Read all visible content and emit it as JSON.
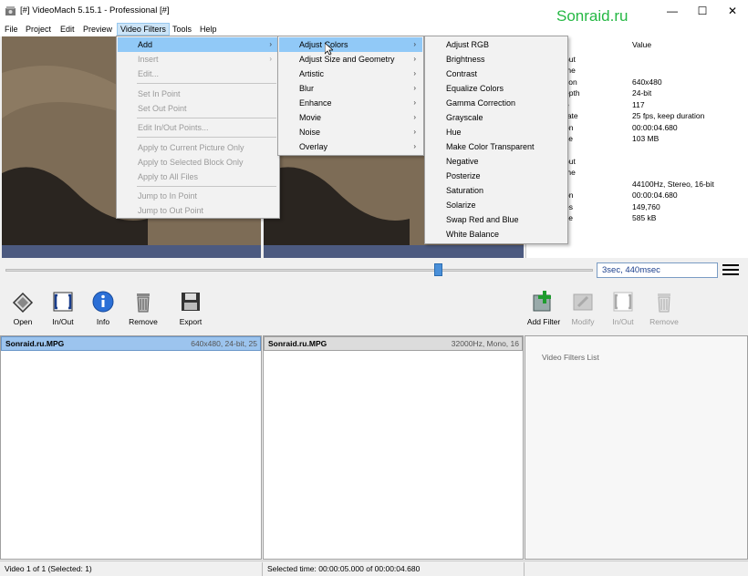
{
  "window": {
    "title": "[#] VideoMach 5.15.1 - Professional [#]",
    "watermark": "Sonraid.ru",
    "minimize": "—",
    "maximize": "☐",
    "close": "✕"
  },
  "menubar": [
    "File",
    "Project",
    "Edit",
    "Preview",
    "Video Filters",
    "Tools",
    "Help"
  ],
  "menus": {
    "video_filters": {
      "items": [
        {
          "label": "Add",
          "enabled": true,
          "submenu": true,
          "highlighted": true
        },
        {
          "label": "Insert",
          "enabled": false,
          "submenu": true
        },
        {
          "label": "Edit...",
          "enabled": false
        },
        {
          "label": "Set In Point",
          "enabled": false
        },
        {
          "label": "Set Out Point",
          "enabled": false
        },
        {
          "label": "Edit In/Out Points...",
          "enabled": false
        },
        {
          "label": "Apply to Current Picture Only",
          "enabled": false
        },
        {
          "label": "Apply to Selected Block Only",
          "enabled": false
        },
        {
          "label": "Apply to All Files",
          "enabled": false
        },
        {
          "label": "Jump to In Point",
          "enabled": false
        },
        {
          "label": "Jump to Out Point",
          "enabled": false
        }
      ]
    },
    "add": {
      "items": [
        "Adjust Colors",
        "Adjust Size and Geometry",
        "Artistic",
        "Blur",
        "Enhance",
        "Movie",
        "Noise",
        "Overlay"
      ],
      "highlighted": "Adjust Colors"
    },
    "adjust_colors": {
      "items": [
        "Adjust RGB",
        "Brightness",
        "Contrast",
        "Equalize Colors",
        "Gamma Correction",
        "Grayscale",
        "Hue",
        "Make Color Transparent",
        "Negative",
        "Posterize",
        "Saturation",
        "Solarize",
        "Swap Red and Blue",
        "White Balance"
      ]
    }
  },
  "properties": {
    "header": "Value",
    "rows": [
      {
        "key": "put",
        "value": ""
      },
      {
        "key": "me",
        "value": ""
      },
      {
        "key": "tion",
        "value": "640x480"
      },
      {
        "key": "epth",
        "value": "24-bit"
      },
      {
        "key": "e",
        "value": "117"
      },
      {
        "key": "rate",
        "value": "25 fps, keep duration"
      },
      {
        "key": "on",
        "value": "00:00:04.680"
      },
      {
        "key": "ze",
        "value": "103 MB"
      },
      {
        "key": "put",
        "value": ""
      },
      {
        "key": "me",
        "value": ""
      },
      {
        "key": "",
        "value": "44100Hz, Stereo, 16-bit"
      },
      {
        "key": "on",
        "value": "00:00:04.680"
      },
      {
        "key": "es",
        "value": "149,760"
      },
      {
        "key": "ze",
        "value": "585 kB"
      }
    ]
  },
  "seek": {
    "time": "3sec, 440msec",
    "position": 0.73
  },
  "toolbar_left": [
    {
      "label": "Open",
      "icon": "open-icon"
    },
    {
      "label": "In/Out",
      "icon": "inout-icon"
    },
    {
      "label": "Info",
      "icon": "info-icon"
    },
    {
      "label": "Remove",
      "icon": "trash-icon"
    },
    {
      "label": "Export",
      "icon": "save-icon"
    }
  ],
  "toolbar_right": [
    {
      "label": "Add Filter",
      "icon": "add-filter-icon",
      "enabled": true
    },
    {
      "label": "Modify",
      "icon": "modify-icon",
      "enabled": false
    },
    {
      "label": "In/Out",
      "icon": "inout-icon",
      "enabled": false
    },
    {
      "label": "Remove",
      "icon": "trash-icon",
      "enabled": false
    }
  ],
  "panels": {
    "video": {
      "name": "Sonraid.ru.MPG",
      "info": "640x480, 24-bit, 25"
    },
    "audio": {
      "name": "Sonraid.ru.MPG",
      "info": "32000Hz, Mono, 16"
    },
    "filters": {
      "label": "Video Filters List"
    }
  },
  "status": {
    "left": "Video 1 of 1  (Selected: 1)",
    "middle": "Selected time:  00:00:05.000  of  00:00:04.680"
  },
  "colors": {
    "accent": "#91c9f7",
    "watermark": "#25b844",
    "time_text": "#1a3e8c"
  }
}
